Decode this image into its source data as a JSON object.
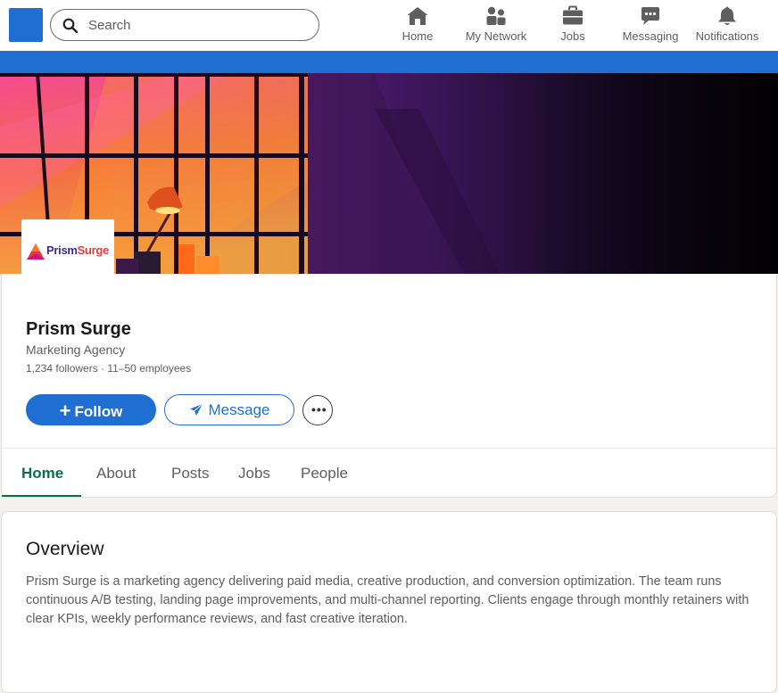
{
  "nav": {
    "search_placeholder": "Search",
    "items": [
      {
        "label": "Home",
        "icon": "home-icon"
      },
      {
        "label": "My Network",
        "icon": "people-icon"
      },
      {
        "label": "Jobs",
        "icon": "briefcase-icon"
      },
      {
        "label": "Messaging",
        "icon": "chat-icon"
      },
      {
        "label": "Notifications",
        "icon": "bell-icon"
      }
    ]
  },
  "colors": {
    "brand_blue": "#1f6ed1",
    "active_tab_green": "#0a6e4e",
    "logo_purple": "#3a2c8e",
    "logo_red": "#e03a3e"
  },
  "company": {
    "logo_part1": "Prism",
    "logo_part2": "Surge",
    "name": "Prism Surge",
    "industry": "Marketing Agency",
    "meta": "1,234 followers · 11–50 employees"
  },
  "actions": {
    "follow_label": "Follow",
    "message_label": "Message",
    "more_label": "•••"
  },
  "tabs": [
    {
      "label": "Home",
      "active": true
    },
    {
      "label": "About"
    },
    {
      "label": "Posts"
    },
    {
      "label": "Jobs"
    },
    {
      "label": "People"
    }
  ],
  "overview": {
    "title": "Overview",
    "body": "Prism Surge is a marketing agency delivering paid media, creative production, and conversion optimization. The team runs continuous A/B testing, landing page improvements, and multi-channel reporting. Clients engage through monthly retainers with clear KPIs, weekly performance reviews, and fast creative iteration."
  }
}
